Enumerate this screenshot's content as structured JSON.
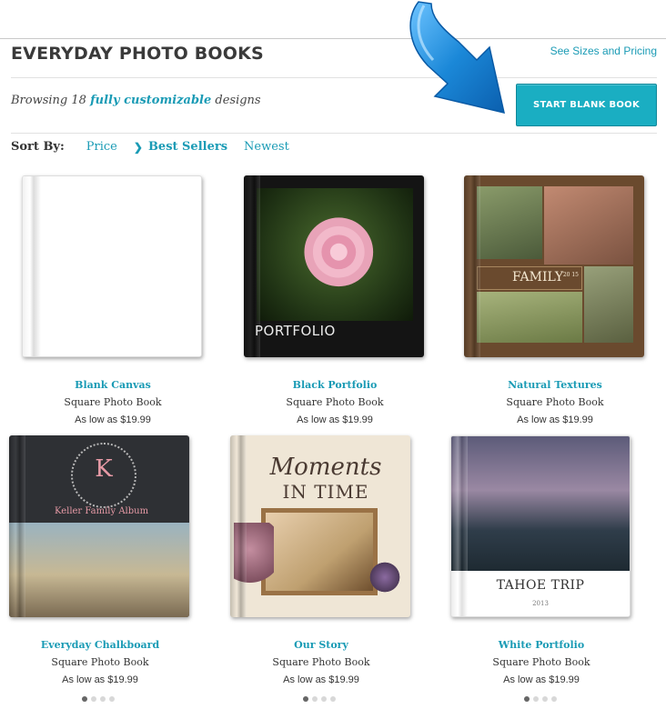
{
  "header": {
    "title": "EVERYDAY PHOTO BOOKS",
    "sizes_link": "See Sizes and Pricing"
  },
  "browse": {
    "prefix": "Browsing",
    "count": "18",
    "accent": "fully customizable",
    "suffix": "designs"
  },
  "cta": {
    "label": "START BLANK BOOK"
  },
  "sort": {
    "label": "Sort By:",
    "options": [
      "Price",
      "Best Sellers",
      "Newest"
    ],
    "selected": "Best Sellers"
  },
  "products": [
    {
      "name": "Blank Canvas",
      "type": "Square Photo Book",
      "price": "As low as $19.99"
    },
    {
      "name": "Black Portfolio",
      "type": "Square Photo Book",
      "price": "As low as $19.99",
      "cover_text": "PORTFOLIO"
    },
    {
      "name": "Natural Textures",
      "type": "Square Photo Book",
      "price": "As low as $19.99",
      "cover_text": "FAMILY",
      "cover_sub": "20 15"
    },
    {
      "name": "Everyday Chalkboard",
      "type": "Square Photo Book",
      "price": "As low as $19.99",
      "cover_text": "K",
      "cover_sub": "Keller Family Album"
    },
    {
      "name": "Our Story",
      "type": "Square Photo Book",
      "price": "As low as $19.99",
      "cover_text": "Moments",
      "cover_sub": "IN TIME"
    },
    {
      "name": "White Portfolio",
      "type": "Square Photo Book",
      "price": "As low as $19.99",
      "cover_text": "TAHOE TRIP",
      "cover_sub": "2013"
    }
  ],
  "pagination": {
    "dots_per_group": 4,
    "active_index": 0
  },
  "colors": {
    "accent": "#1a9bb5",
    "cta": "#1aaec2",
    "arrow": "#1b88d8"
  }
}
